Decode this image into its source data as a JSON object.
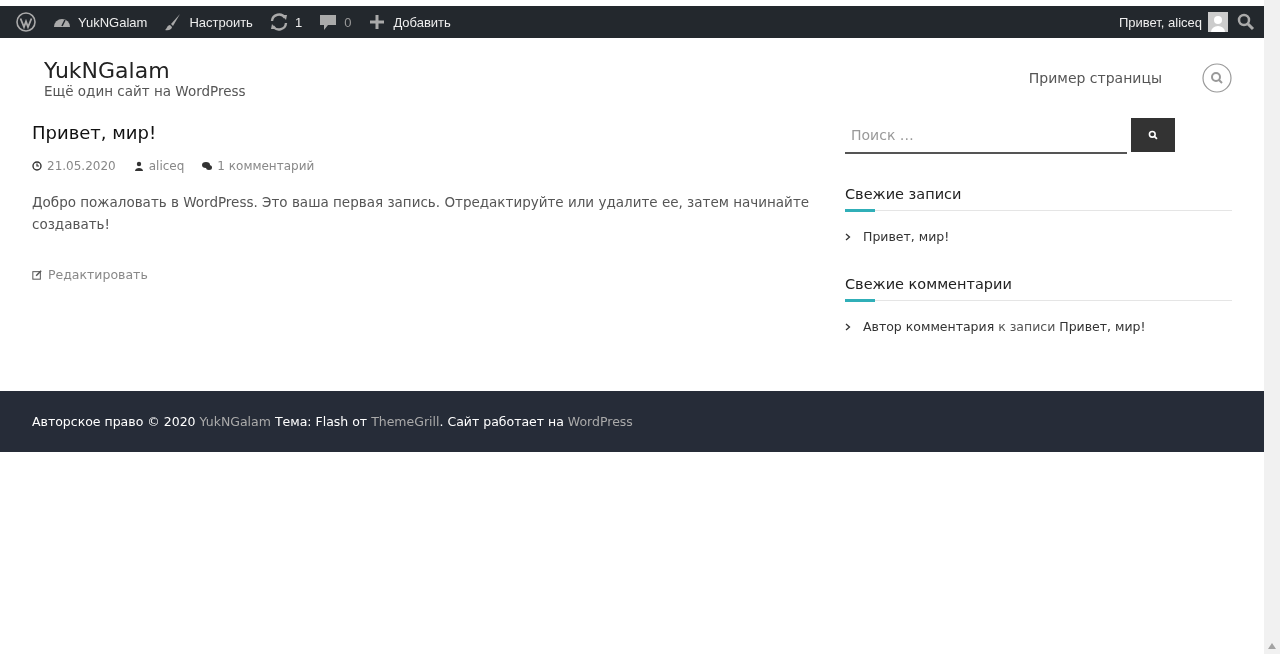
{
  "admin_bar": {
    "items": [
      {
        "kind": "wp"
      },
      {
        "kind": "site",
        "label": "YukNGalam"
      },
      {
        "kind": "customize",
        "label": "Настроить"
      },
      {
        "kind": "updates",
        "label": "1"
      },
      {
        "kind": "comments",
        "label": "0"
      },
      {
        "kind": "new",
        "label": "Добавить"
      }
    ],
    "greeting": "Привет, aliceq"
  },
  "header": {
    "site_title": "YukNGalam",
    "tagline": "Ещё один сайт на WordPress",
    "nav": [
      "Пример страницы"
    ]
  },
  "post": {
    "title": "Привет, мир!",
    "date": "21.05.2020",
    "author": "aliceq",
    "comments": "1 комментарий",
    "content": "Добро пожаловать в WordPress. Это ваша первая запись. Отредактируйте или удалите ее, затем начинайте создавать!",
    "edit": "Редактировать"
  },
  "sidebar": {
    "search": {
      "placeholder": "Поиск …"
    },
    "widgets": [
      {
        "title": "Свежие записи",
        "items": [
          [
            {
              "kind": "link",
              "text": "Привет, мир!"
            }
          ]
        ]
      },
      {
        "title": "Свежие комментарии",
        "items": [
          [
            {
              "kind": "link",
              "text": "Автор комментария"
            },
            {
              "kind": "text",
              "text": " к записи "
            },
            {
              "kind": "link",
              "text": "Привет, мир!"
            }
          ]
        ]
      }
    ]
  },
  "footer": {
    "parts": [
      {
        "kind": "text",
        "text": "Авторское право © 2020 "
      },
      {
        "kind": "link",
        "text": "YukNGalam"
      },
      {
        "kind": "text",
        "text": " Тема: Flash от "
      },
      {
        "kind": "link",
        "text": "ThemeGrill"
      },
      {
        "kind": "text",
        "text": ". Сайт работает на "
      },
      {
        "kind": "link",
        "text": "WordPress"
      }
    ]
  }
}
